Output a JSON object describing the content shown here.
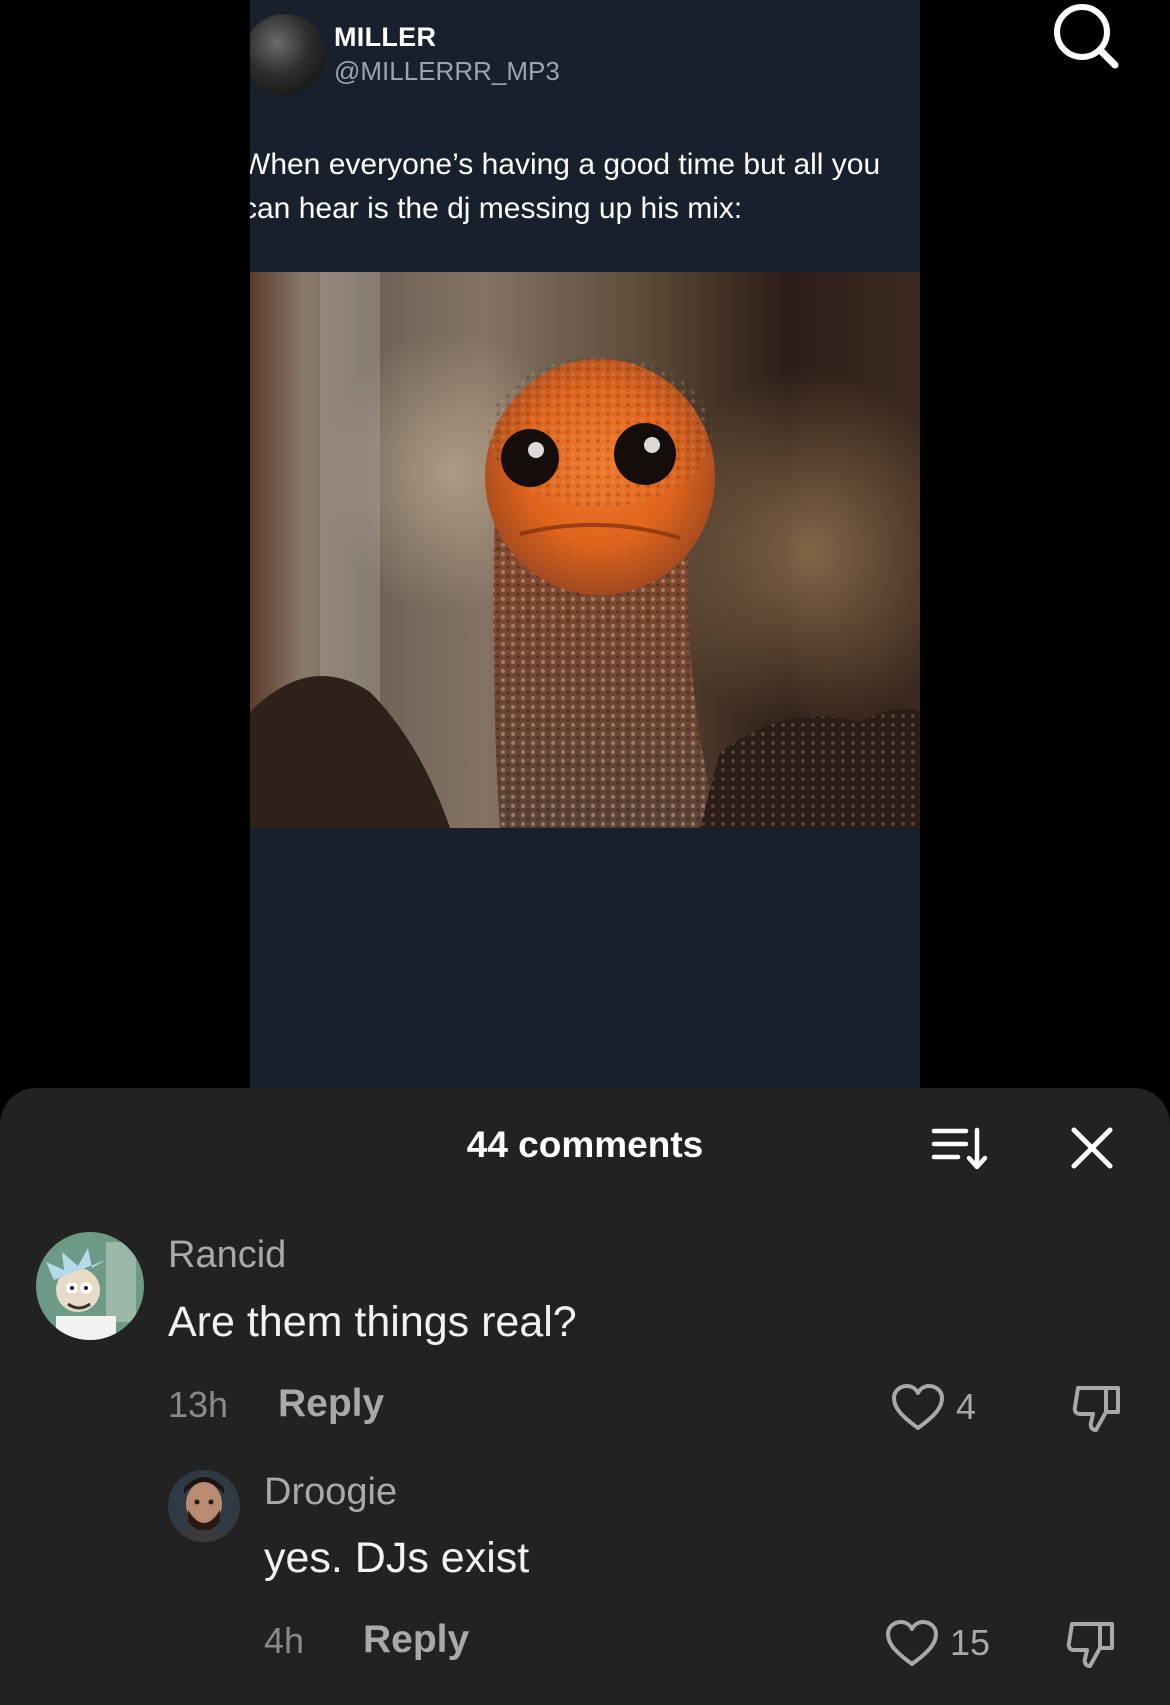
{
  "tweet": {
    "name": "MILLER",
    "handle": "@MILLERRR_MP3",
    "text_lines": [
      "When everyone’s having a good time but all you",
      "can hear is the dj messing up his mix:"
    ]
  },
  "icons": {
    "search": "search-icon",
    "sort": "sort-icon",
    "close": "close-icon",
    "like": "heart-icon",
    "dislike": "thumbs-down-icon"
  },
  "comments_sheet": {
    "title": "44 comments",
    "comments": [
      {
        "user": "Rancid",
        "text": "Are them things real?",
        "time": "13h",
        "reply_label": "Reply",
        "likes": "4"
      },
      {
        "user": "Droogie",
        "text": "yes. DJs exist",
        "time": "4h",
        "reply_label": "Reply",
        "likes": "15"
      }
    ]
  },
  "colors": {
    "tweet_background": "#19202d",
    "sheet_background": "#222222",
    "secondary_text": "#a9a9a9"
  }
}
